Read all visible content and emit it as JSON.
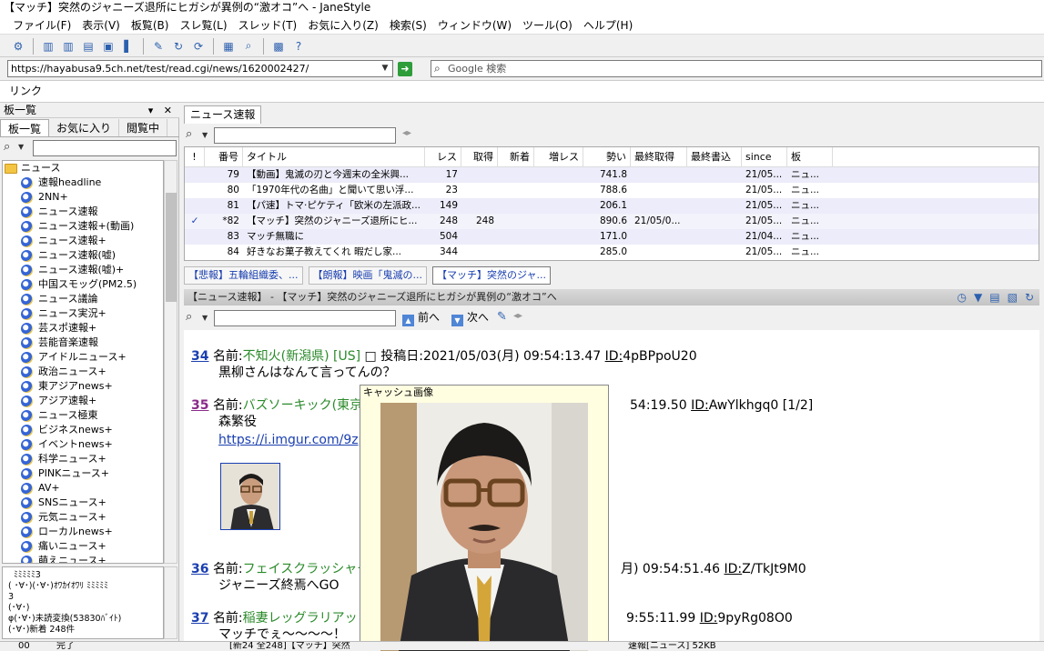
{
  "window": {
    "title": "【マッチ】突然のジャニーズ退所にヒガシが異例の“激オコ”へ - JaneStyle"
  },
  "menu": [
    "ファイル(F)",
    "表示(V)",
    "板覧(B)",
    "スレ覧(L)",
    "スレッド(T)",
    "お気に入り(Z)",
    "検索(S)",
    "ウィンドウ(W)",
    "ツール(O)",
    "ヘルプ(H)"
  ],
  "address": {
    "url": "https://hayabusa9.5ch.net/test/read.cgi/news/1620002427/",
    "go_icon": "arrow-right-icon"
  },
  "google": {
    "placeholder": "Google 検索"
  },
  "linkbar": {
    "label": "リンク"
  },
  "leftpane": {
    "title": "板一覧",
    "tabs": [
      "板一覧",
      "お気に入り",
      "閲覧中"
    ],
    "folder": "ニュース",
    "boards": [
      "速報headline",
      "2NN+",
      "ニュース速報",
      "ニュース速報+(動画)",
      "ニュース速報+",
      "ニュース速報(嘘)",
      "ニュース速報(嘘)+",
      "中国スモッグ(PM2.5)",
      "ニュース議論",
      "ニュース実況+",
      "芸スポ速報+",
      "芸能音楽速報",
      "アイドルニュース+",
      "政治ニュース+",
      "東アジアnews+",
      "アジア速報+",
      "ニュース極東",
      "ビジネスnews+",
      "イベントnews+",
      "科学ニュース+",
      "PINKニュース+",
      "AV+",
      "SNSニュース+",
      "元気ニュース+",
      "ローカルnews+",
      "痛いニュース+",
      "萌えニュース+"
    ],
    "memo": "  ﾐﾐﾐﾐﾐ3\n( ･∀･)(･∀･)ｵﾜｶｲｵﾜﾘ ﾐﾐﾐﾐﾐ\n3\n(･∀･)\nφ(･∀･)未読変換(53830ﾊﾞｲﾄ)\n(･∀･)新着 248件"
  },
  "threadlist": {
    "tab": "ニュース速報",
    "columns": [
      "!",
      "番号",
      "タイトル",
      "レス",
      "取得",
      "新着",
      "増レス",
      "勢い",
      "最終取得",
      "最終書込",
      "since",
      "板"
    ],
    "rows": [
      {
        "mark": "",
        "num": "79",
        "title": "【動画】鬼滅の刃と今週末の全米興...",
        "res": "17",
        "got": "",
        "new": "",
        "inc": "",
        "momentum": "741.8",
        "lastget": "",
        "lastwrite": "",
        "since": "21/05...",
        "board": "ニュ..."
      },
      {
        "mark": "",
        "num": "80",
        "title": "「1970年代の名曲」と聞いて思い浮...",
        "res": "23",
        "got": "",
        "new": "",
        "inc": "",
        "momentum": "788.6",
        "lastget": "",
        "lastwrite": "",
        "since": "21/05...",
        "board": "ニュ..."
      },
      {
        "mark": "",
        "num": "81",
        "title": "【パ速】トマ·ピケティ「欧米の左派政...",
        "res": "149",
        "got": "",
        "new": "",
        "inc": "",
        "momentum": "206.1",
        "lastget": "",
        "lastwrite": "",
        "since": "21/05...",
        "board": "ニュ..."
      },
      {
        "mark": "✓",
        "num": "*82",
        "title": "【マッチ】突然のジャニーズ退所にヒ...",
        "res": "248",
        "got": "248",
        "new": "",
        "inc": "",
        "momentum": "890.6",
        "lastget": "21/05/0...",
        "lastwrite": "",
        "since": "21/05...",
        "board": "ニュ..."
      },
      {
        "mark": "",
        "num": "83",
        "title": "マッチ無職に",
        "res": "504",
        "got": "",
        "new": "",
        "inc": "",
        "momentum": "171.0",
        "lastget": "",
        "lastwrite": "",
        "since": "21/04...",
        "board": "ニュ..."
      },
      {
        "mark": "",
        "num": "84",
        "title": "好きなお菓子教えてくれ 暇だし家...",
        "res": "344",
        "got": "",
        "new": "",
        "inc": "",
        "momentum": "285.0",
        "lastget": "",
        "lastwrite": "",
        "since": "21/05...",
        "board": "ニュ..."
      }
    ]
  },
  "subtabs": [
    "【悲報】五輪組織委、...",
    "【朗報】映画「鬼滅の...",
    "【マッチ】突然のジャ..."
  ],
  "viewer": {
    "header": "【ニュース速報】 - 【マッチ】突然のジャニーズ退所にヒガシが異例の“激オコ”へ",
    "prev": "前へ",
    "next": "次へ",
    "posts": [
      {
        "num": "34",
        "label": "名前:",
        "name": "不知火(新潟県) [US]",
        "extra": "投稿日:2021/05/03(月) 09:54:13.47",
        "idlabel": "ID:",
        "id": "4pBPpoU20",
        "body": "黒柳さんはなんて言ってんの？"
      },
      {
        "num": "35",
        "label": "名前:",
        "name": "バズソーキック(東京",
        "extra": "54:19.50",
        "idlabel": "ID:",
        "id": "AwYlkhgq0",
        "count": "[1/2]",
        "body": "森繁役",
        "link": "https://i.imgur.com/9zp"
      },
      {
        "num": "36",
        "label": "名前:",
        "name": "フェイスクラッシャー",
        "extra": "月) 09:54:51.46",
        "idlabel": "ID:",
        "id": "Z/TkJt9M0",
        "body": "ジャニーズ終焉へGO"
      },
      {
        "num": "37",
        "label": "名前:",
        "name": "稲妻レッグラリアッ",
        "extra": "9:55:11.99",
        "idlabel": "ID:",
        "id": "9pyRg08O0",
        "body": "マッチでぇ～～～～！"
      }
    ]
  },
  "popup": {
    "title": "キャッシュ画像"
  },
  "status": {
    "left": "00",
    "mid": "完了",
    "thread": "[新24 全248]【マッチ】突然",
    "right": "速報[ニュース] 52KB"
  }
}
